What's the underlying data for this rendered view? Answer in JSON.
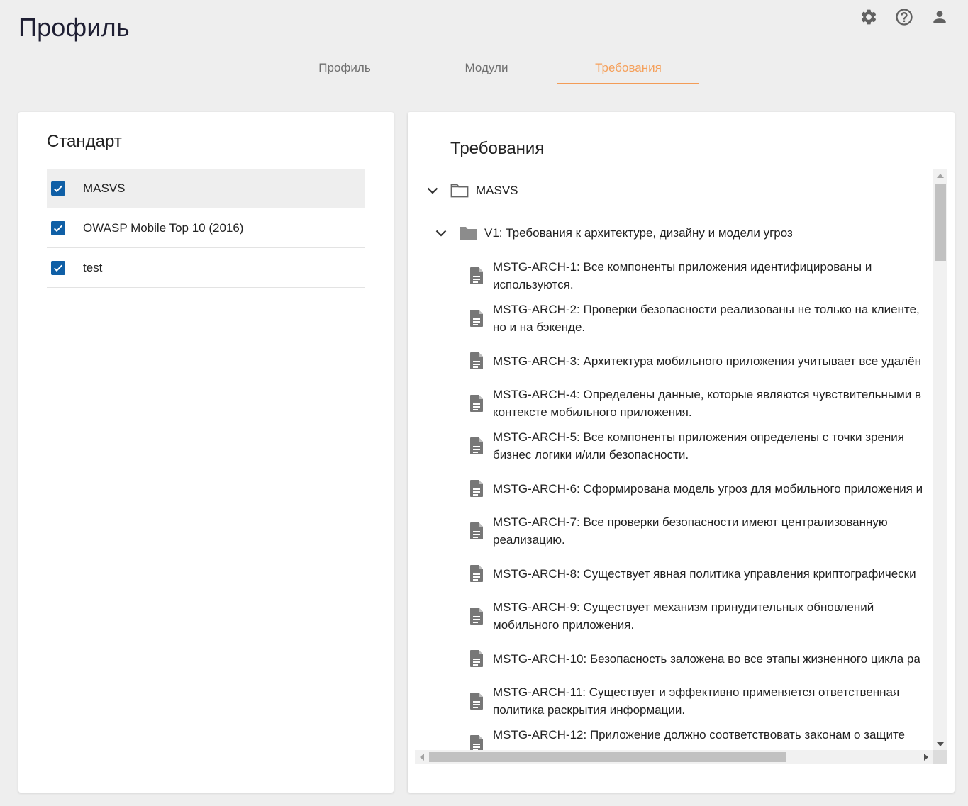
{
  "page": {
    "title": "Профиль"
  },
  "header_icons": [
    "gear-icon",
    "help-icon",
    "account-icon"
  ],
  "tabs": [
    {
      "label": "Профиль",
      "active": false
    },
    {
      "label": "Модули",
      "active": false
    },
    {
      "label": "Требования",
      "active": true
    }
  ],
  "standards": {
    "title": "Стандарт",
    "items": [
      {
        "label": "MASVS",
        "checked": true,
        "selected": true
      },
      {
        "label": "OWASP Mobile Top 10 (2016)",
        "checked": true,
        "selected": false
      },
      {
        "label": "test",
        "checked": true,
        "selected": false
      }
    ]
  },
  "requirements": {
    "title": "Требования",
    "root": {
      "label": "MASVS",
      "expanded": true
    },
    "group": {
      "label": "V1: Требования к архитектуре, дизайну и модели угроз",
      "expanded": true
    },
    "items": [
      {
        "label": "MSTG-ARCH-1: Все компоненты приложения идентифицированы и используются."
      },
      {
        "label": "MSTG-ARCH-2: Проверки безопасности реализованы не только на клиенте, но и на бэкенде."
      },
      {
        "label": "MSTG-ARCH-3: Архитектура мобильного приложения учитывает все удалён"
      },
      {
        "label": "MSTG-ARCH-4: Определены данные, которые являются чувствительными в контексте мобильного приложения."
      },
      {
        "label": "MSTG-ARCH-5: Все компоненты приложения определены с точки зрения бизнес логики и/или безопасности."
      },
      {
        "label": "MSTG-ARCH-6: Сформирована модель угроз для мобильного приложения и"
      },
      {
        "label": "MSTG-ARCH-7: Все проверки безопасности имеют централизованную реализацию."
      },
      {
        "label": "MSTG-ARCH-8: Существует явная политика управления криптографически"
      },
      {
        "label": "MSTG-ARCH-9: Существует механизм принудительных обновлений мобильного приложения."
      },
      {
        "label": "MSTG-ARCH-10: Безопасность заложена во все этапы жизненного цикла ра"
      },
      {
        "label": "MSTG-ARCH-11: Существует и эффективно применяется ответственная политика раскрытия информации."
      },
      {
        "label": "MSTG-ARCH-12: Приложение должно соответствовать законам о защите"
      }
    ]
  }
}
